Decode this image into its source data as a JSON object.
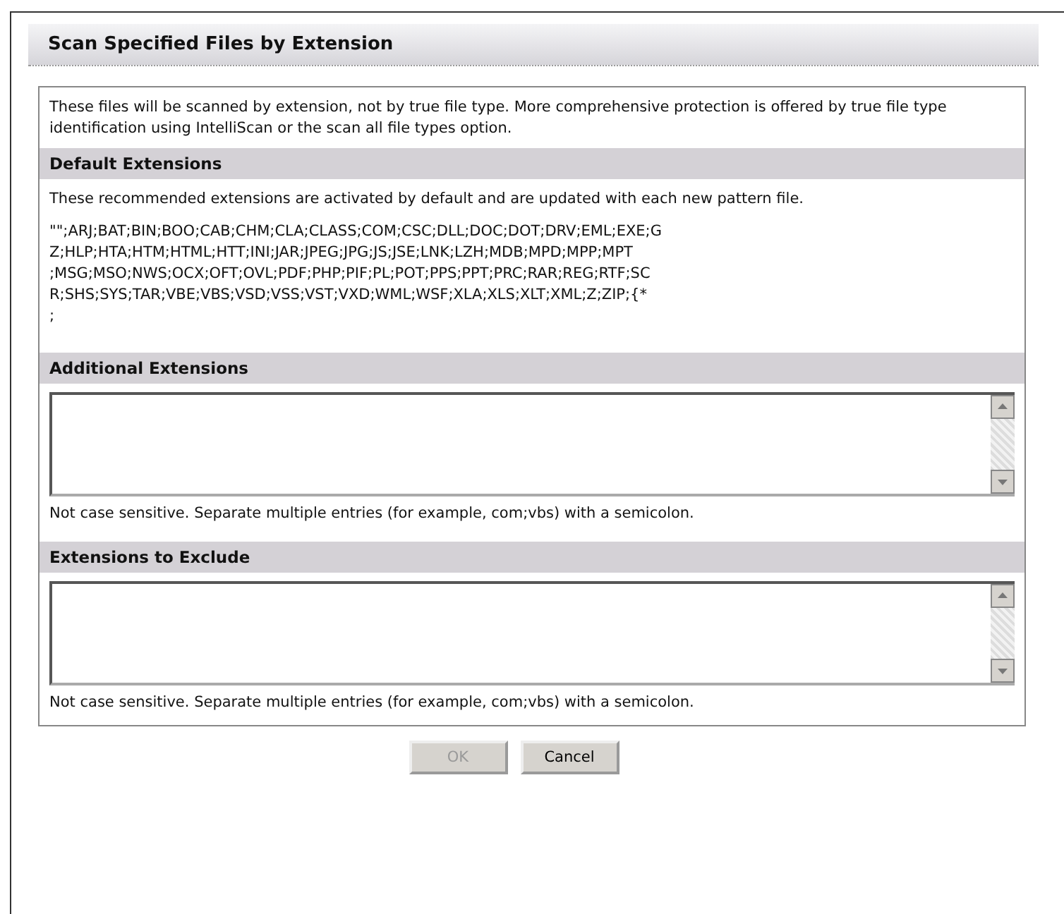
{
  "title": "Scan Specified Files by Extension",
  "intro": "These files will be scanned by extension, not by true file type. More comprehensive protection is offered by true file type identification using IntelliScan or the scan all file types option.",
  "sections": [
    {
      "kind": "list",
      "heading": "Default Extensions",
      "description": "These recommended extensions are activated by default and are updated with each new pattern file.",
      "lines": [
        "\"\";ARJ;BAT;BIN;BOO;CAB;CHM;CLA;CLASS;COM;CSC;DLL;DOC;DOT;DRV;EML;EXE;G",
        "Z;HLP;HTA;HTM;HTML;HTT;INI;JAR;JPEG;JPG;JS;JSE;LNK;LZH;MDB;MPD;MPP;MPT",
        ";MSG;MSO;NWS;OCX;OFT;OVL;PDF;PHP;PIF;PL;POT;PPS;PPT;PRC;RAR;REG;RTF;SC",
        "R;SHS;SYS;TAR;VBE;VBS;VSD;VSS;VST;VXD;WML;WSF;XLA;XLS;XLT;XML;Z;ZIP;{*",
        ";"
      ]
    },
    {
      "kind": "input",
      "heading": "Additional Extensions",
      "note": "Not case sensitive. Separate multiple entries (for example, com;vbs) with a semicolon."
    },
    {
      "kind": "input",
      "heading": "Extensions to Exclude",
      "note": "Not case sensitive. Separate multiple entries (for example, com;vbs) with a semicolon."
    }
  ],
  "buttons": [
    {
      "label": "OK",
      "disabled": true
    },
    {
      "label": "Cancel",
      "disabled": false
    }
  ]
}
